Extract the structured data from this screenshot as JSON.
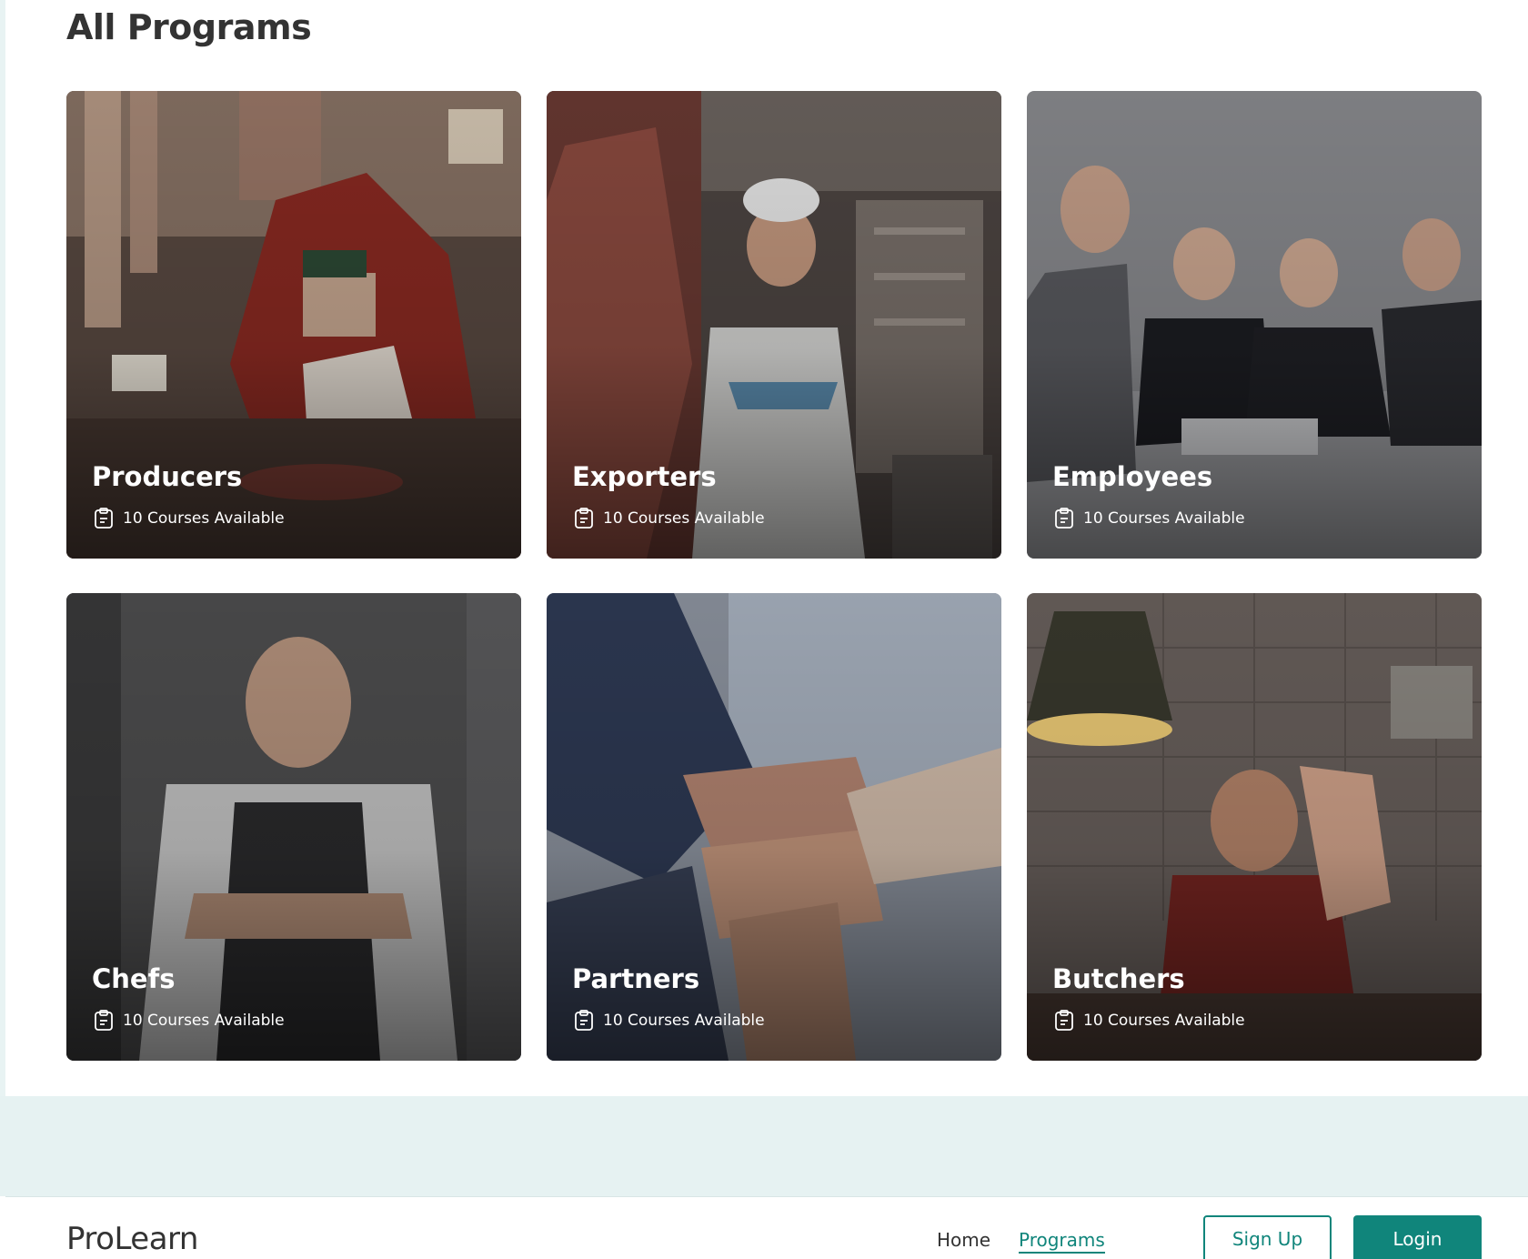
{
  "section": {
    "title": "All Programs"
  },
  "programs": [
    {
      "name": "Producers",
      "courses": "10 Courses Available",
      "image": "butcher-slicing-meat"
    },
    {
      "name": "Exporters",
      "courses": "10 Courses Available",
      "image": "worker-in-meat-warehouse"
    },
    {
      "name": "Employees",
      "courses": "10 Courses Available",
      "image": "businessmen-at-table"
    },
    {
      "name": "Chefs",
      "courses": "10 Courses Available",
      "image": "chef-arms-crossed"
    },
    {
      "name": "Partners",
      "courses": "10 Courses Available",
      "image": "stacked-hands"
    },
    {
      "name": "Butchers",
      "courses": "10 Courses Available",
      "image": "butcher-holding-poultry"
    }
  ],
  "navbar": {
    "brand": "ProLearn",
    "links": [
      {
        "label": "Home",
        "active": false
      },
      {
        "label": "Programs",
        "active": true
      }
    ],
    "signup_label": "Sign Up",
    "login_label": "Login"
  },
  "colors": {
    "accent": "#10857b",
    "band": "#e6f2f2",
    "title": "#333333"
  }
}
